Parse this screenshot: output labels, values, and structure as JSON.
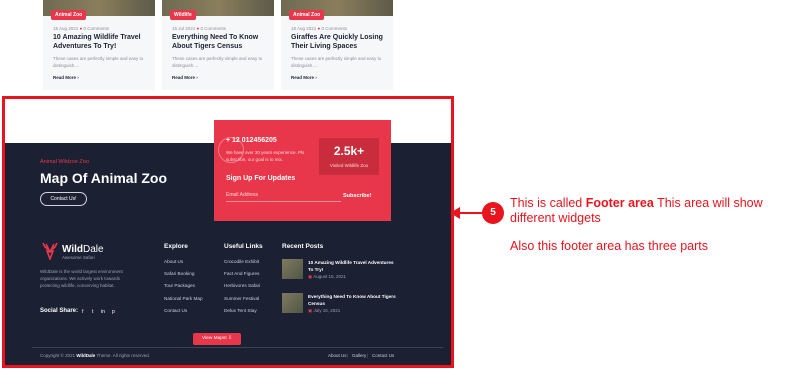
{
  "cards": [
    {
      "tag": "Animal Zoo",
      "date": "18 Aug 2021",
      "comments": "0 Comments",
      "title": "10 Amazing Wildlife Travel Adventures To Try!",
      "excerpt": "These cases are perfectly simple and easy to distinguish....",
      "read_more": "Read More"
    },
    {
      "tag": "Wildlife",
      "date": "16 Jul 2021",
      "comments": "0 Comments",
      "title": "Everything Need To Know About Tigers Census",
      "excerpt": "These cases are perfectly simple and easy to distinguish....",
      "read_more": "Read More"
    },
    {
      "tag": "Animal Zoo",
      "date": "18 Aug 2021",
      "comments": "0 Comments",
      "title": "Giraffes Are Quickly Losing Their Living Spaces",
      "excerpt": "These cases are perfectly simple and easy to distinguish....",
      "read_more": "Read More"
    }
  ],
  "footer": {
    "cta": {
      "kicker": "Animal Wildzoe Zoo",
      "title": "Map Of Animal Zoo",
      "button": "Contact Us!"
    },
    "promo": {
      "phone": "+ 12 012456205",
      "desc": "We have over 30 years experience. Pls subscribe, our goal is to mix.",
      "stat_value": "2.5k+",
      "stat_label": "Visited Wildlife Zoo",
      "signup_title": "Sign Up For Updates",
      "email_placeholder": "Email Address",
      "subscribe": "Subscribe!"
    },
    "brand": {
      "name_part1": "Wild",
      "name_part2": "Dale",
      "tagline": "Awesome Safari",
      "about": "WildDale is the world largest environment organizations. We actively work towards protecting wildlife, conserving habitat."
    },
    "social_label": "Social Share:",
    "social_icons": [
      "f",
      "t",
      "in",
      "p"
    ],
    "explore": {
      "heading": "Explore",
      "links": [
        "About Us",
        "Safari Booking",
        "Tour Packages",
        "National Park Map",
        "Contact Us"
      ]
    },
    "useful": {
      "heading": "Useful Links",
      "links": [
        "Crocodile Exhibit",
        "Fact And Figures",
        "Herbivores Safari",
        "Summer Festival",
        "Delux Tent Stay"
      ]
    },
    "recent": {
      "heading": "Recent Posts",
      "posts": [
        {
          "title": "10 Amazing Wildlife Travel Adventures To Try!",
          "date": "August 15, 2021"
        },
        {
          "title": "Everything Need To Know About Tigers Census",
          "date": "July 16, 2021"
        }
      ]
    },
    "view_maps": "View Maps! ⇩",
    "copyright_pre": "Copyright © 2021 ",
    "copyright_brand": "WildDale",
    "copyright_post": " Theme. All rights reserved.",
    "bottom_links": [
      "About Us",
      "Gallery",
      "Contact Us"
    ]
  },
  "annotation": {
    "step": "5",
    "line1_pre": "This is called ",
    "line1_bold": "Footer area",
    "line1_post": " This area will show",
    "line2": "different widgets",
    "line3": "Also this footer area has three parts"
  },
  "colors": {
    "accent": "#e8374b",
    "annotation": "#e8141e",
    "footer_bg": "#1b2133"
  }
}
